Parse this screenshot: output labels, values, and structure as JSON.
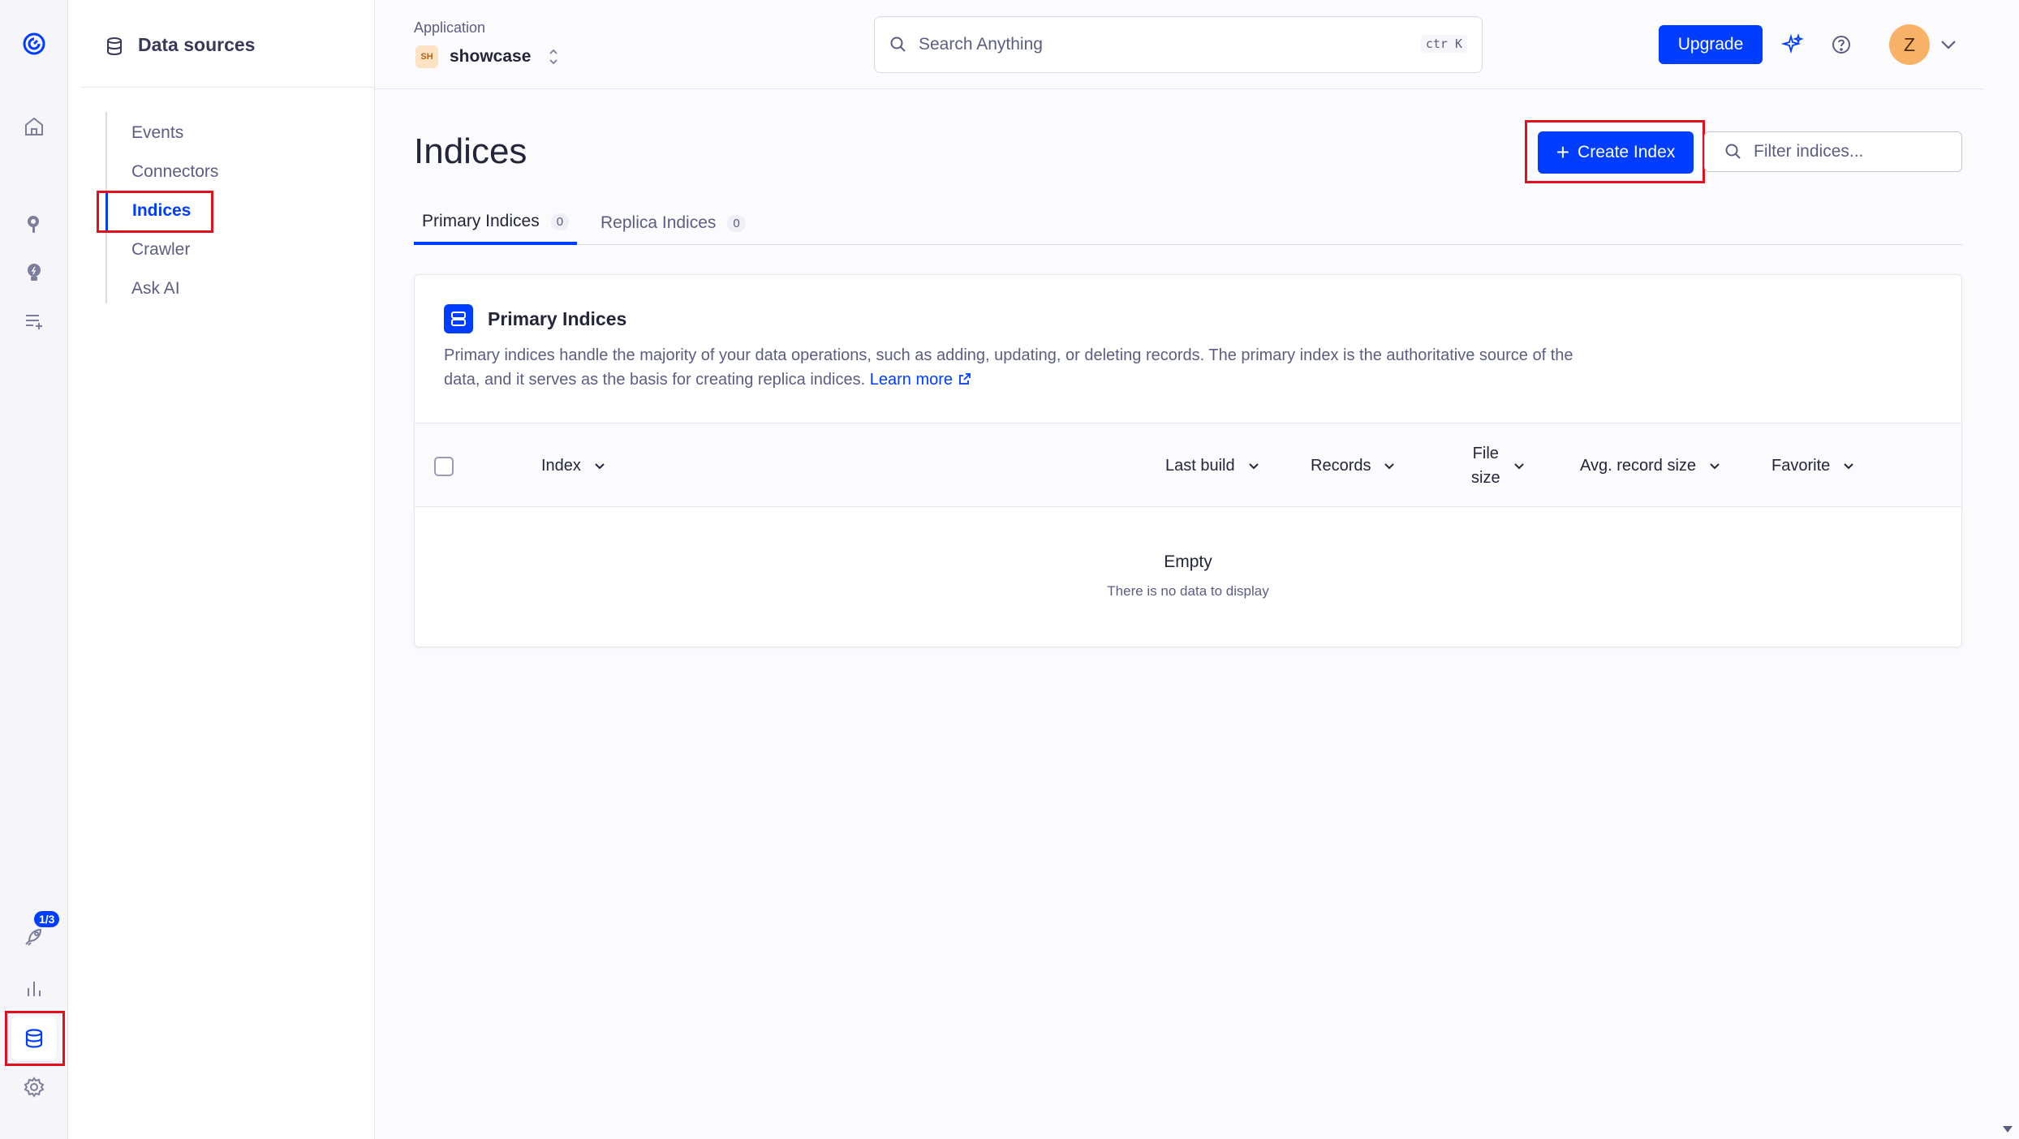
{
  "rail": {
    "badge": "1/3"
  },
  "subnav": {
    "title": "Data sources",
    "items": [
      {
        "label": "Events"
      },
      {
        "label": "Connectors"
      },
      {
        "label": "Indices"
      },
      {
        "label": "Crawler"
      },
      {
        "label": "Ask AI"
      }
    ],
    "active": "Indices"
  },
  "topbar": {
    "app_label": "Application",
    "app_avatar": "SH",
    "app_name": "showcase",
    "search_placeholder": "Search Anything",
    "search_shortcut": "ctr K",
    "upgrade_label": "Upgrade",
    "user_initial": "Z"
  },
  "page": {
    "title": "Indices",
    "create_label": "Create Index",
    "filter_placeholder": "Filter indices..."
  },
  "tabs": [
    {
      "label": "Primary Indices",
      "count": "0",
      "active": true
    },
    {
      "label": "Replica Indices",
      "count": "0",
      "active": false
    }
  ],
  "card": {
    "title": "Primary Indices",
    "description": "Primary indices handle the majority of your data operations, such as adding, updating, or deleting records. The primary index is the authoritative source of the data, and it serves as the basis for creating replica indices.",
    "learn_more": "Learn more",
    "columns": [
      {
        "label": "Index"
      },
      {
        "label": "Last build"
      },
      {
        "label": "Records"
      },
      {
        "label": "File",
        "label2": "size"
      },
      {
        "label": "Avg. record size"
      },
      {
        "label": "Favorite"
      }
    ],
    "empty_title": "Empty",
    "empty_subtitle": "There is no data to display"
  },
  "colors": {
    "accent": "#003dff",
    "highlight": "#e0101e",
    "avatar": "#f7b267"
  }
}
